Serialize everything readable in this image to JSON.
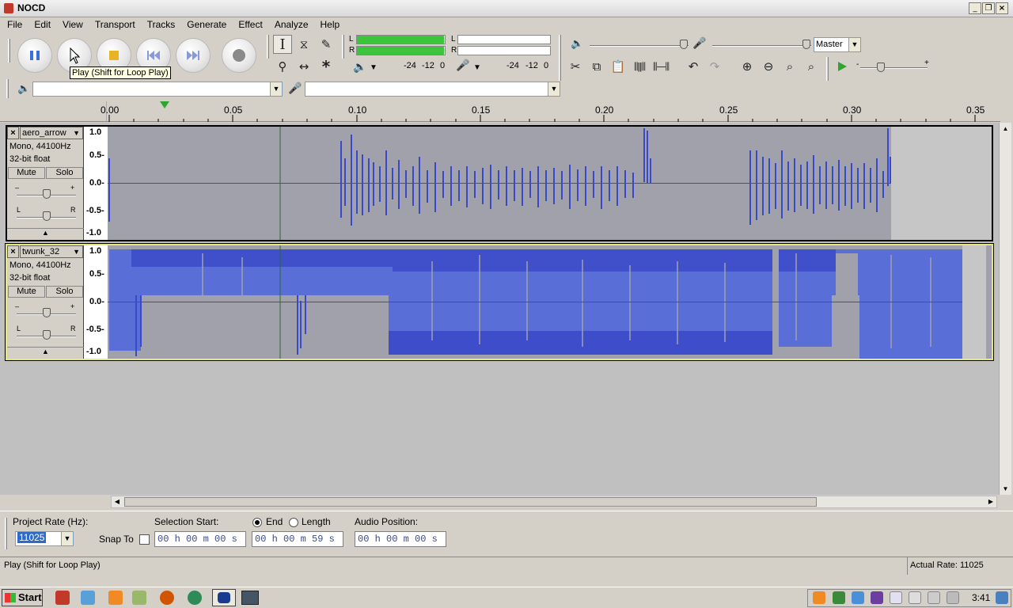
{
  "window": {
    "title": "NOCD"
  },
  "menu": [
    "File",
    "Edit",
    "View",
    "Transport",
    "Tracks",
    "Generate",
    "Effect",
    "Analyze",
    "Help"
  ],
  "transport": {
    "tooltip": "Play (Shift for Loop Play)",
    "buttons": [
      "pause-icon",
      "play-icon",
      "stop-icon",
      "skip-start-icon",
      "skip-end-icon",
      "record-icon"
    ]
  },
  "meters": {
    "play_db_labels": [
      "-24",
      "-12",
      "0"
    ],
    "rec_db_labels": [
      "-24",
      "-12",
      "0"
    ],
    "lr": [
      "L",
      "R"
    ]
  },
  "mixer": {
    "source_select": "Master"
  },
  "ruler": {
    "labels": [
      "0.00",
      "0.05",
      "0.10",
      "0.15",
      "0.20",
      "0.25",
      "0.30",
      "0.35"
    ]
  },
  "tracks": [
    {
      "name": "aero_arrow",
      "info1": "Mono, 44100Hz",
      "info2": "32-bit float",
      "mute": "Mute",
      "solo": "Solo",
      "scale": [
        "1.0",
        "0.5-",
        "0.0-",
        "-0.5-",
        "-1.0"
      ],
      "gain_lr": [
        "L",
        "R"
      ]
    },
    {
      "name": "twunk_32",
      "info1": "Mono, 44100Hz",
      "info2": "32-bit float",
      "mute": "Mute",
      "solo": "Solo",
      "scale": [
        "1.0",
        "0.5-",
        "0.0-",
        "-0.5-",
        "-1.0"
      ],
      "gain_lr": [
        "L",
        "R"
      ]
    }
  ],
  "bottom": {
    "project_rate_label": "Project Rate (Hz):",
    "project_rate_value": "11025",
    "snap_to_label": "Snap To",
    "selection_start_label": "Selection Start:",
    "selection_start_value": "00 h 00 m 00 s",
    "end_label": "End",
    "length_label": "Length",
    "end_value": "00 h 00 m 59 s",
    "audio_position_label": "Audio Position:",
    "audio_position_value": "00 h 00 m 00 s"
  },
  "status": {
    "left": "Play (Shift for Loop Play)",
    "right": "Actual Rate: 11025"
  },
  "taskbar": {
    "start_label": "Start",
    "clock": "3:41"
  }
}
